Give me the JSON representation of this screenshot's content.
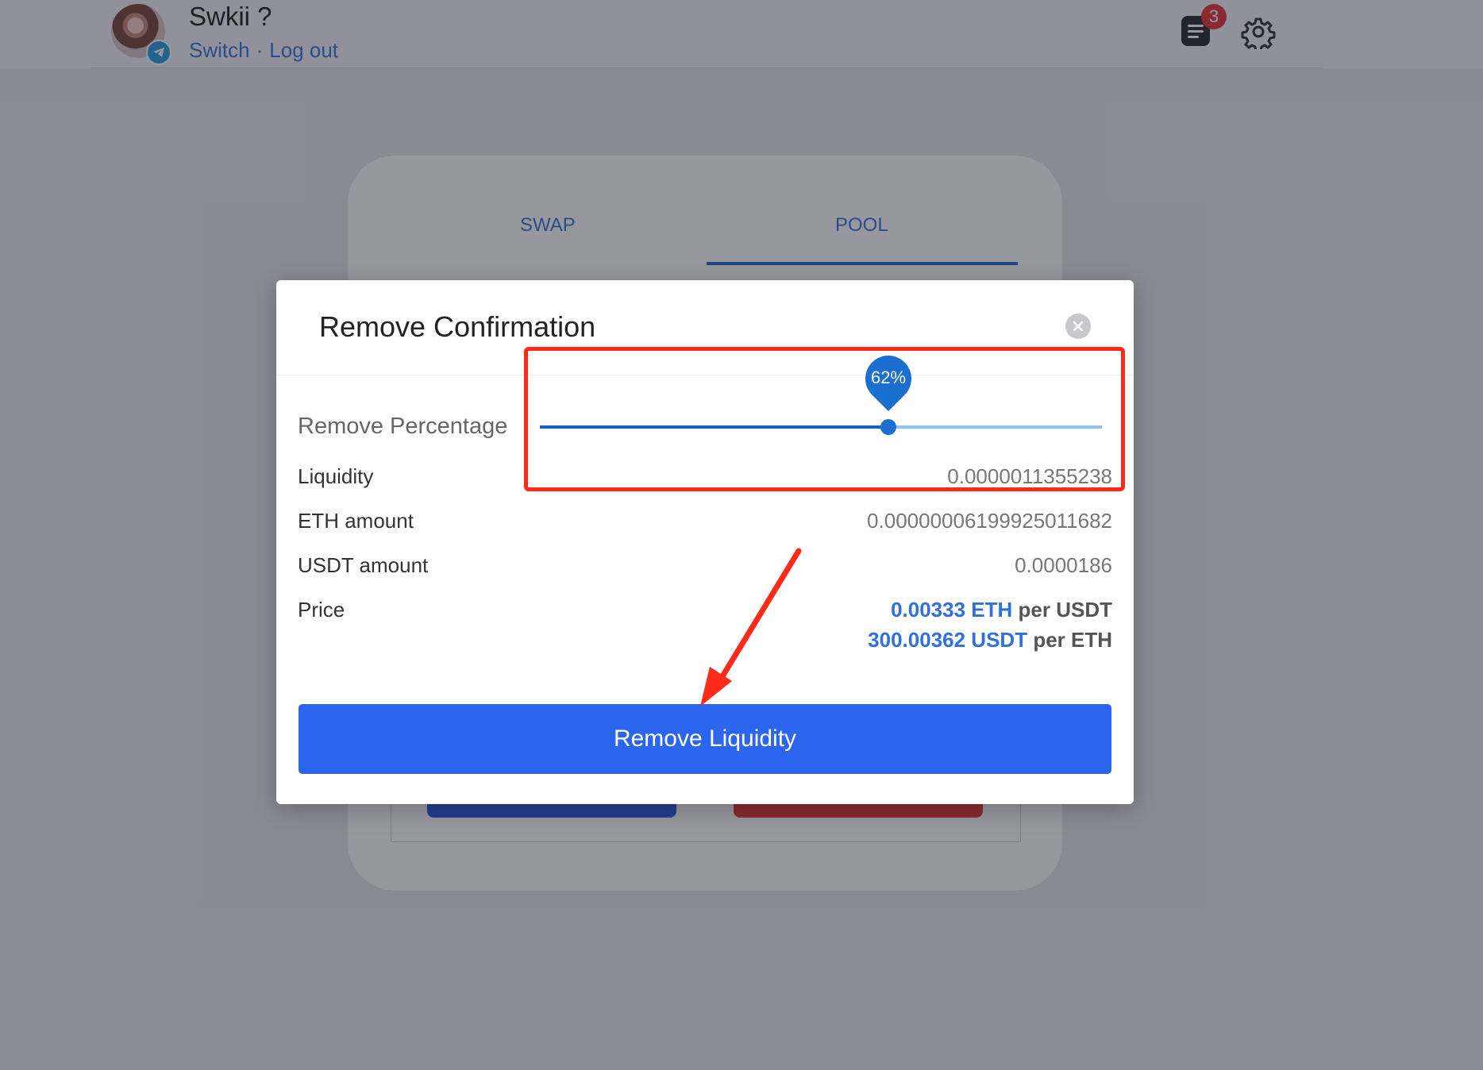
{
  "header": {
    "user_name": "Swkii ?",
    "switch_label": "Switch",
    "separator": "·",
    "logout_label": "Log out",
    "notification_count": "3"
  },
  "tabs": [
    {
      "label": "SWAP",
      "active": false
    },
    {
      "label": "POOL",
      "active": true
    }
  ],
  "modal": {
    "title": "Remove Confirmation",
    "percentage_label": "Remove Percentage",
    "slider": {
      "value": 62,
      "display": "62%"
    },
    "rows": [
      {
        "label": "Liquidity",
        "value": "0.0000011355238"
      },
      {
        "label": "ETH amount",
        "value": "0.00000006199925011682"
      },
      {
        "label": "USDT amount",
        "value": "0.0000186"
      }
    ],
    "price": {
      "label": "Price",
      "line1_value": "0.00333 ETH",
      "line1_suffix": "per USDT",
      "line2_value": "300.00362 USDT",
      "line2_suffix": "per ETH"
    },
    "button_label": "Remove Liquidity"
  },
  "colors": {
    "accent": "#2d66ee",
    "annotation": "#ff2a1a",
    "slider": "#1a6fd0"
  },
  "icons": [
    "avatar-telegram-badge",
    "document-icon",
    "gear-icon",
    "close-icon"
  ]
}
